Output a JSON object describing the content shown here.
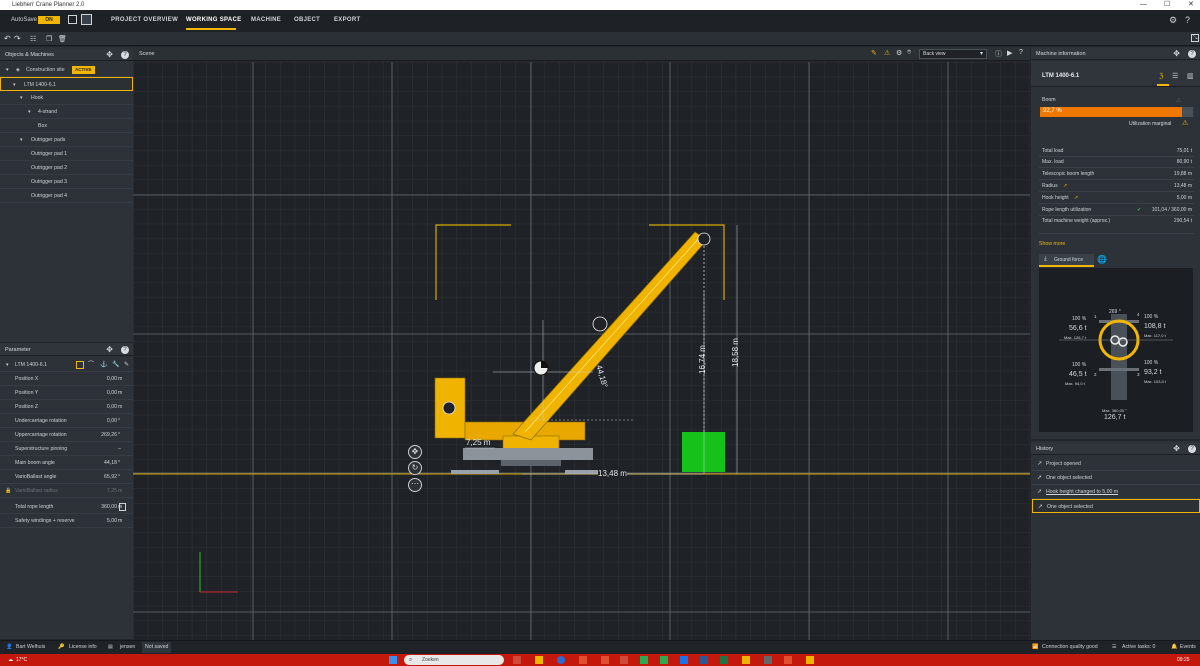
{
  "window": {
    "title": "Liebherr Crane Planner 2.0"
  },
  "menubar": {
    "autosave_label": "AutoSave",
    "autosave_toggle": "ON",
    "tabs": [
      "PROJECT OVERVIEW",
      "WORKING SPACE",
      "MACHINE",
      "OBJECT",
      "EXPORT"
    ],
    "active_tab": "WORKING SPACE"
  },
  "left_top": {
    "title": "Objects & Machines",
    "tree": [
      {
        "label": "Construction site",
        "badge": "ACTIVE"
      },
      {
        "label": "LTM 1400-6.1"
      },
      {
        "label": "Hook"
      },
      {
        "label": "4-strand"
      },
      {
        "label": "Box"
      },
      {
        "label": "Outrigger pads"
      },
      {
        "label": "Outrigger pad 1"
      },
      {
        "label": "Outrigger pad 2"
      },
      {
        "label": "Outrigger pad 3"
      },
      {
        "label": "Outrigger pad 4"
      }
    ]
  },
  "parameter": {
    "title": "Parameter",
    "machine": "LTM 1400-6.1",
    "rows": [
      {
        "label": "Position X",
        "value": "0,00",
        "unit": "m"
      },
      {
        "label": "Position Y",
        "value": "0,00",
        "unit": "m"
      },
      {
        "label": "Position Z",
        "value": "0,00",
        "unit": "m"
      },
      {
        "label": "Undercarriage rotation",
        "value": "0,00",
        "unit": "°"
      },
      {
        "label": "Uppercarriage rotation",
        "value": "269,26",
        "unit": "°"
      },
      {
        "label": "Superstructure pinning",
        "value": "",
        "unit": "–"
      },
      {
        "label": "Main boom angle",
        "value": "44,18",
        "unit": "°"
      },
      {
        "label": "VarioBallast angle",
        "value": "65,92",
        "unit": "°"
      },
      {
        "label": "VarioBallast radius",
        "value": "7,25",
        "unit": "m"
      },
      {
        "label": "Total rope length",
        "value": "360,00",
        "unit": "m"
      },
      {
        "label": "Safety windings + reserve",
        "value": "5,00",
        "unit": "m"
      }
    ]
  },
  "scene": {
    "title": "Scene",
    "view_select": "Back view",
    "dims": {
      "angle": "44,18°",
      "ballast": "7,25 m",
      "radius": "13,48 m",
      "hook": "16,74 m",
      "height": "18,58 m"
    }
  },
  "machine_info": {
    "title": "Machine information",
    "machine": "LTM 1400-6.1",
    "boom_label": "Boom",
    "utilization": "92,7 %",
    "utilization_fraction": 0.927,
    "utilization_note": "Utilization marginal",
    "rows": [
      {
        "label": "Total load",
        "value": "75,01 t"
      },
      {
        "label": "Max. load",
        "value": "80,90 t"
      },
      {
        "label": "Telescopic boom length",
        "value": "19,88 m"
      },
      {
        "label": "Radius",
        "value": "13,48 m"
      },
      {
        "label": "Hook height",
        "value": "5,00 m"
      },
      {
        "label": "Rope length utilization",
        "value": "101,04 / 360,00 m"
      },
      {
        "label": "Total machine weight (approx.)",
        "value": "290,54 t"
      }
    ],
    "show_more": "Show more",
    "ground_force_tab": "Ground force",
    "ground": {
      "top_angle": "269 °",
      "pads": [
        {
          "pct": "100 %",
          "load": "56,6 t",
          "max": "Max. 126,7 t"
        },
        {
          "pct": "100 %",
          "load": "108,8 t",
          "max": "Max. 117,0 t"
        },
        {
          "pct": "100 %",
          "load": "46,5 t",
          "max": "Max. 94,0 t"
        },
        {
          "pct": "100 %",
          "load": "93,2 t",
          "max": "Max. 103,0 t"
        }
      ],
      "pad_numbers": [
        "1",
        "4",
        "2",
        "3"
      ],
      "bottom_max": "Max. 360,00 °",
      "bottom_total": "126,7 t"
    }
  },
  "history": {
    "title": "History",
    "items": [
      {
        "text": "Project opened"
      },
      {
        "text": "One object selected"
      },
      {
        "text": "Hook height changed to 5,00 m"
      },
      {
        "text": "One object selected"
      }
    ]
  },
  "statusbar": {
    "user": "Bart Welhuis",
    "license": "License info",
    "project": "jensen",
    "saved": "Not saved",
    "connection": "Connection quality good",
    "tasks": "Active tasks: 0",
    "events": "Events"
  },
  "taskbar": {
    "weather": "17°C",
    "search": "Zoeken",
    "time": "09:25"
  },
  "colors": {
    "accent": "#f2b600",
    "util_bar": "#f07800",
    "load_box": "#16c21a",
    "crane": "#f0b400"
  }
}
